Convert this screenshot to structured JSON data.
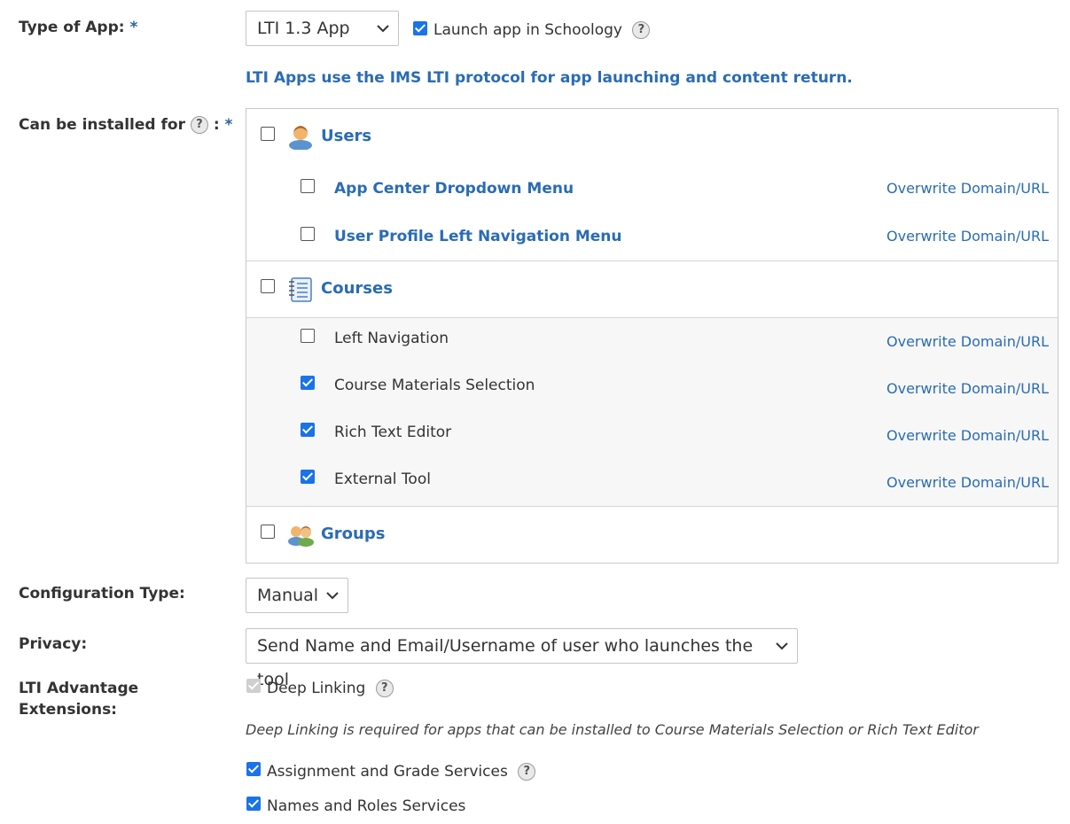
{
  "type_of_app": {
    "label": "Type of App:",
    "required": "*",
    "select_value": "LTI 1.3 App",
    "launch_label": "Launch app in Schoology",
    "launch_checked": true,
    "help": "?",
    "info": "LTI Apps use the IMS LTI protocol for app launching and content return."
  },
  "installed_for": {
    "label": "Can be installed for",
    "suffix": ":",
    "required": "*",
    "help": "?",
    "sections": [
      {
        "title": "Users",
        "icon": "user-icon",
        "checked": false,
        "items": [
          {
            "label": "App Center Dropdown Menu",
            "checked": false,
            "link": "Overwrite Domain/URL"
          },
          {
            "label": "User Profile Left Navigation Menu",
            "checked": false,
            "link": "Overwrite Domain/URL"
          }
        ]
      },
      {
        "title": "Courses",
        "icon": "notebook-icon",
        "checked": false,
        "items": [
          {
            "label": "Left Navigation",
            "checked": false,
            "link": "Overwrite Domain/URL"
          },
          {
            "label": "Course Materials Selection",
            "checked": true,
            "link": "Overwrite Domain/URL"
          },
          {
            "label": "Rich Text Editor",
            "checked": true,
            "link": "Overwrite Domain/URL"
          },
          {
            "label": "External Tool",
            "checked": true,
            "link": "Overwrite Domain/URL"
          }
        ]
      },
      {
        "title": "Groups",
        "icon": "group-icon",
        "checked": false,
        "items": []
      }
    ]
  },
  "configuration_type": {
    "label": "Configuration Type:",
    "value": "Manual"
  },
  "privacy": {
    "label": "Privacy:",
    "value": "Send Name and Email/Username of user who launches the tool"
  },
  "lti_advantage": {
    "label_line1": "LTI Advantage",
    "label_line2": "Extensions:",
    "deep_linking": {
      "label": "Deep Linking",
      "checked": true,
      "disabled": true,
      "help": "?"
    },
    "deep_linking_note": "Deep Linking is required for apps that can be installed to Course Materials Selection or Rich Text Editor",
    "assignment_grade": {
      "label": "Assignment and Grade Services",
      "checked": true,
      "help": "?"
    },
    "names_roles": {
      "label": "Names and Roles Services",
      "checked": true
    }
  },
  "colors": {
    "accent": "#2a6cb4",
    "checkbox": "#1a73e8",
    "border": "#c9c9c9"
  }
}
